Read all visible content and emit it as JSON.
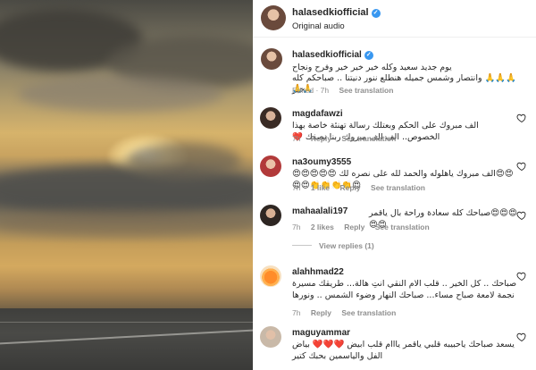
{
  "post": {
    "author": "halasedkiofficial",
    "audio": "Original audio",
    "caption_name": "halasedkiofficial",
    "caption_line1": "يوم جديد سعيد وكله خير خير خير وفرح ونجاح",
    "caption_line2": "🙏🙏🙏 وانتصار وشمس جميله هنطلع ننور دنيتنا .. صباحكم كله خير",
    "caption_line3": "🙏🙏",
    "caption_meta": {
      "edited": "Edited · 7h",
      "see_translation": "See translation"
    }
  },
  "comments": [
    {
      "user": "magdafawzi",
      "text": "الف مبروك على الحكم وبعتلك رسالة تهنئة خاصة بهذا الخصوص.. الف الف مبروك ربنا نصفك ❤️",
      "time": "7h",
      "likes": "",
      "reply": "Reply",
      "see_translation": "See translation"
    },
    {
      "user": "na3oumy3555",
      "text": "😍😍الف مبروك ياهلوله والحمد لله على نصره لك 😍😍😍😍😍😍👏👏👏👏😍😍",
      "time": "7h",
      "likes": "1 like",
      "reply": "Reply",
      "see_translation": "See translation"
    },
    {
      "user": "mahaalali197",
      "text": "😍😍😍صباحك كله سعادة وراحة بال ياقمر 😍😍",
      "time": "7h",
      "likes": "2 likes",
      "reply": "Reply",
      "see_translation": "See translation",
      "view_replies": "View replies (1)"
    },
    {
      "user": "alahhmad22",
      "text": "صباحك .. كل الخير .. قلب الام النقي انتِ هالة... طريقك مسيرة نجمة لامعة صباح مساء... صباحك النهار وضوء الشمس .. ونورها",
      "time": "7h",
      "likes": "",
      "reply": "Reply",
      "see_translation": "See translation"
    },
    {
      "user": "maguyammar",
      "text": "يسعد صباحك ياحبيبه قلبي ياقمر يااام قلب ابيض ❤️❤️❤️ بياض الفل والياسمين بحبك كتير",
      "time": "",
      "likes": "",
      "reply": "",
      "see_translation": ""
    }
  ],
  "colors": {
    "accent": "#3897f0",
    "muted": "#8e8e8e",
    "text": "#262626"
  },
  "icons": [
    "verified-icon",
    "heart-icon"
  ]
}
